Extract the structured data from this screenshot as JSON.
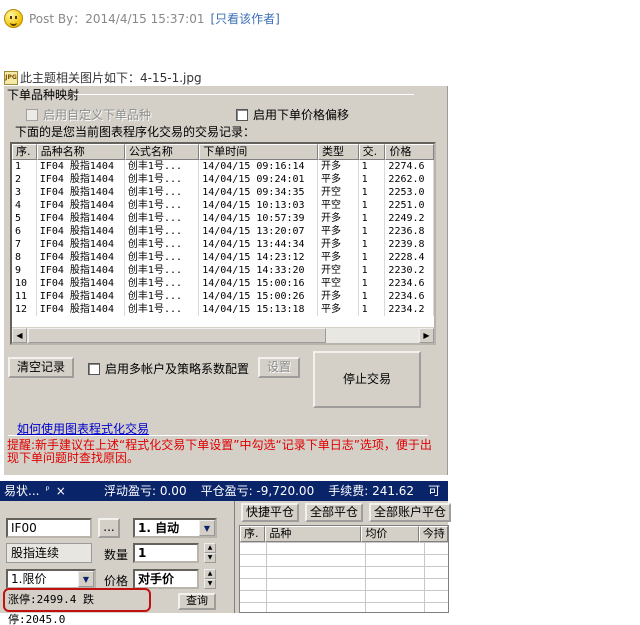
{
  "post": {
    "author_label": "Post By：2014/4/15 15:37:01",
    "view_author_link": "[只看该作者]"
  },
  "attachment": {
    "icon": "jpg-file-icon",
    "text": "此主题相关图片如下：4-15-1.jpg"
  },
  "dialog": {
    "group_title": "下单品种映射",
    "custom_symbol_checkbox": "启用自定义下单品种",
    "price_offset_checkbox": "启用下单价格偏移",
    "list_caption": "下面的是您当前图表程序化交易的交易记录：",
    "columns": [
      "序.",
      "品种名称",
      "公式名称",
      "下单时间",
      "类型",
      "交.",
      "价格"
    ],
    "records": [
      [
        "1",
        "IF04 股指1404",
        "创丰1号...",
        "14/04/15 09:16:14",
        "开多",
        "1",
        "2274.6"
      ],
      [
        "2",
        "IF04 股指1404",
        "创丰1号...",
        "14/04/15 09:24:01",
        "平多",
        "1",
        "2262.0"
      ],
      [
        "3",
        "IF04 股指1404",
        "创丰1号...",
        "14/04/15 09:34:35",
        "开空",
        "1",
        "2253.0"
      ],
      [
        "4",
        "IF04 股指1404",
        "创丰1号...",
        "14/04/15 10:13:03",
        "平空",
        "1",
        "2251.0"
      ],
      [
        "5",
        "IF04 股指1404",
        "创丰1号...",
        "14/04/15 10:57:39",
        "开多",
        "1",
        "2249.2"
      ],
      [
        "6",
        "IF04 股指1404",
        "创丰1号...",
        "14/04/15 13:20:07",
        "平多",
        "1",
        "2236.8"
      ],
      [
        "7",
        "IF04 股指1404",
        "创丰1号...",
        "14/04/15 13:44:34",
        "开多",
        "1",
        "2239.8"
      ],
      [
        "8",
        "IF04 股指1404",
        "创丰1号...",
        "14/04/15 14:23:12",
        "平多",
        "1",
        "2228.4"
      ],
      [
        "9",
        "IF04 股指1404",
        "创丰1号...",
        "14/04/15 14:33:20",
        "开空",
        "1",
        "2230.2"
      ],
      [
        "10",
        "IF04 股指1404",
        "创丰1号...",
        "14/04/15 15:00:16",
        "平空",
        "1",
        "2234.6"
      ],
      [
        "11",
        "IF04 股指1404",
        "创丰1号...",
        "14/04/15 15:00:26",
        "开多",
        "1",
        "2234.6"
      ],
      [
        "12",
        "IF04 股指1404",
        "创丰1号...",
        "14/04/15 15:13:18",
        "平多",
        "1",
        "2234.2"
      ]
    ],
    "clear_button": "清空记录",
    "multi_account_checkbox": "启用多帐户及策略系数配置",
    "settings_button": "设置",
    "stop_button": "停止交易",
    "help_link": "如何使用图表程式化交易",
    "tip_text": "提醒:新手建议在上述“程式化交易下单设置”中勾选“记录下单日志”选项，便于出现下单问题时查找原因。"
  },
  "status": {
    "panel_title": "易状...",
    "pin": "ᵖ",
    "close": "×",
    "floating_pnl": "浮动盈亏: 0.00",
    "closed_pnl": "平仓盈亏: -9,720.00",
    "fee": "手续费: 241.62",
    "more": "可"
  },
  "order_panel": {
    "symbol_value": "IF00",
    "browse_button": "...",
    "mode_value": "1. 自动",
    "contract_name": "股指连续",
    "qty_label": "数量",
    "qty_value": "1",
    "order_type_value": "1.限价",
    "price_label": "价格",
    "price_value": "对手价",
    "limit_text": "涨停:2499.4 跌停:2045.0",
    "query_button": "查询"
  },
  "positions": {
    "quick_close_button": "快捷平仓",
    "close_all_button": "全部平仓",
    "close_all_accounts_button": "全部账户平仓",
    "columns": [
      "序.",
      "品种",
      "均价",
      "今持"
    ]
  }
}
